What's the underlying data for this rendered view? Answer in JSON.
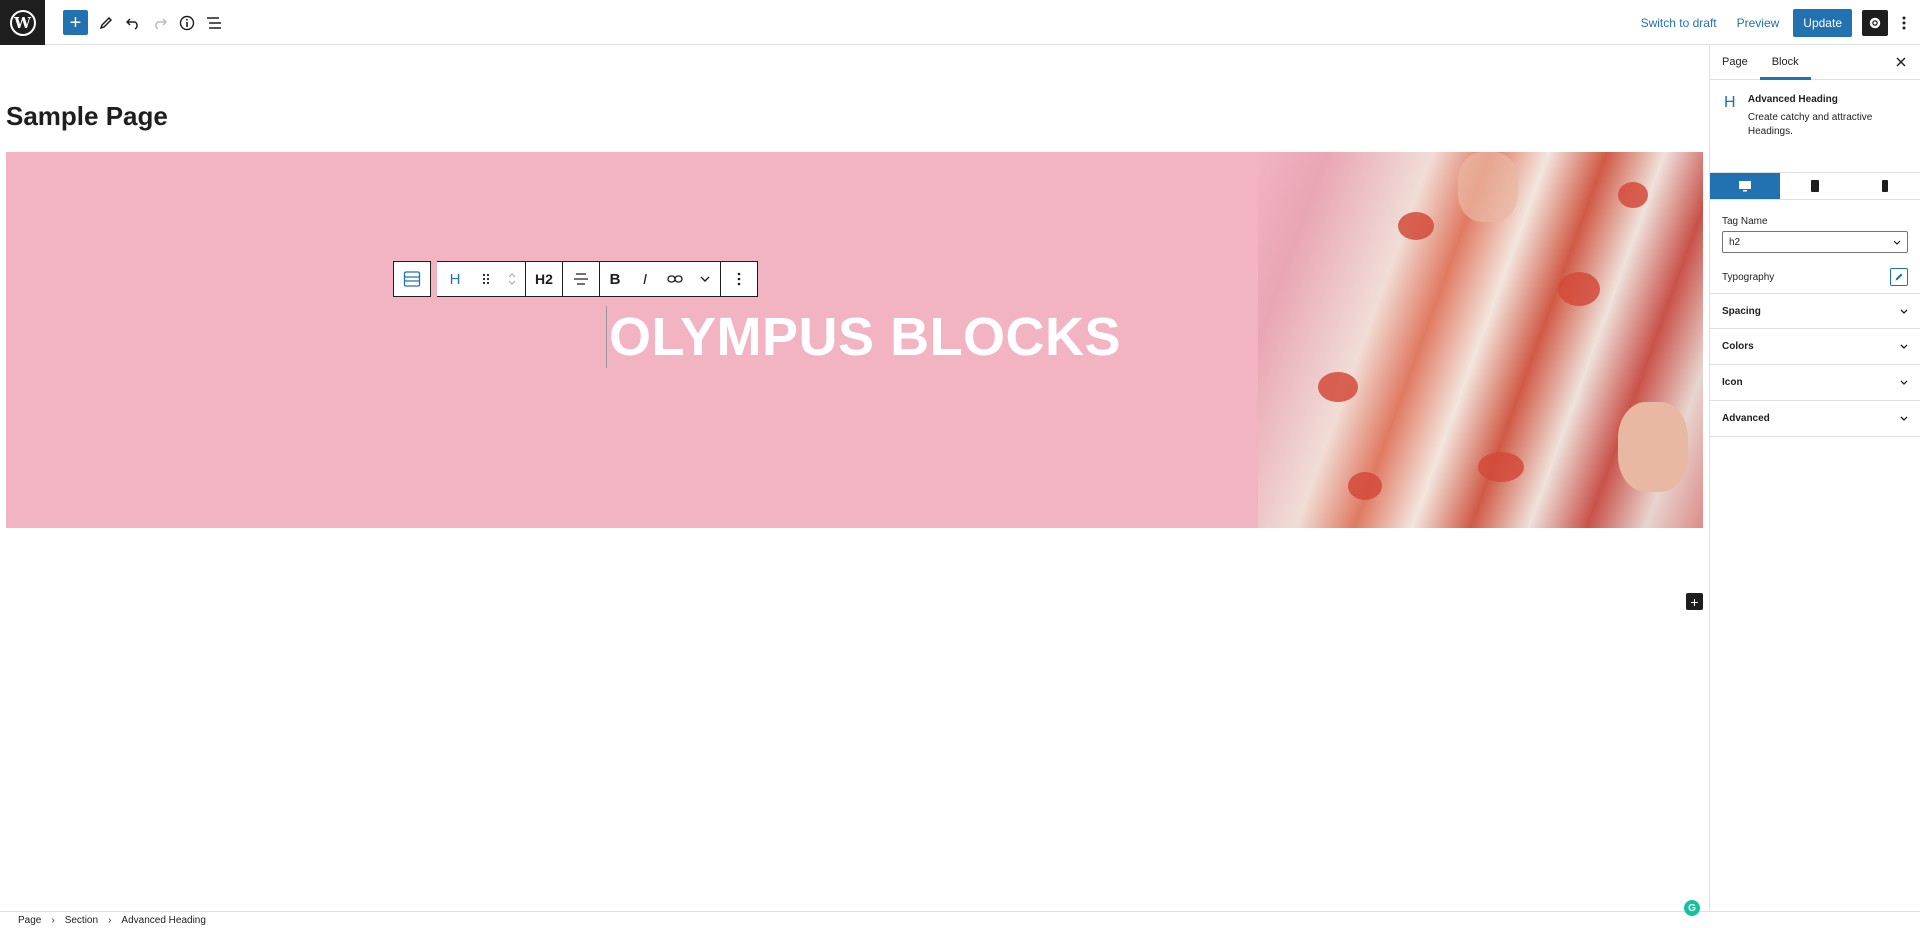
{
  "topbar": {
    "logo_label": "W",
    "add_icon": "+",
    "actions": {
      "switch_to_draft": "Switch to draft",
      "preview": "Preview",
      "update": "Update"
    }
  },
  "editor": {
    "page_title": "Sample Page",
    "heading_text": "OLYMPUS BLOCKS",
    "toolbar": {
      "heading_level": "H2",
      "block_letter": "H"
    },
    "hero_bg_color": "#f2b3c3"
  },
  "sidebar": {
    "tabs": [
      "Page",
      "Block"
    ],
    "active_tab": "Block",
    "block": {
      "icon_letter": "H",
      "title": "Advanced Heading",
      "description": "Create catchy and attractive Headings."
    },
    "active_device": "desktop",
    "tag_name_label": "Tag Name",
    "tag_name_value": "h2",
    "typography_label": "Typography",
    "panels": [
      "Spacing",
      "Colors",
      "Icon",
      "Advanced"
    ]
  },
  "breadcrumb": [
    "Page",
    "Section",
    "Advanced Heading"
  ],
  "colors": {
    "accent": "#2271b1",
    "dark": "#1e1e1e"
  }
}
